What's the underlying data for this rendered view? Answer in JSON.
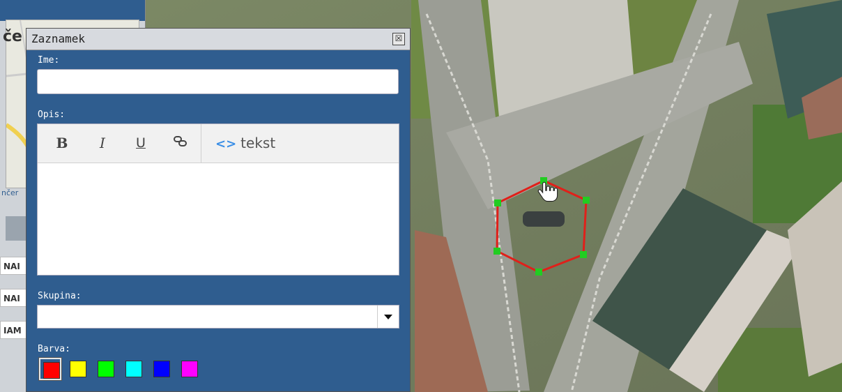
{
  "app": {
    "minimap_title": "če",
    "minimap_label": "nčer",
    "side_tabs": [
      "NAI",
      "NAI",
      "IAM"
    ]
  },
  "dialog": {
    "title": "Zaznamek",
    "close_glyph": "☒",
    "name_label": "Ime:",
    "name_value": "",
    "description_label": "Opis:",
    "toolbar": {
      "bold": "B",
      "italic": "I",
      "underline": "U",
      "link": "⚭",
      "source_icon": "<>",
      "source_label": "tekst"
    },
    "group_label": "Skupina:",
    "group_value": "",
    "color_label": "Barva:",
    "colors": [
      "#ff0000",
      "#ffff00",
      "#00ff00",
      "#00ffff",
      "#0000ff",
      "#ff00ff"
    ],
    "selected_color_index": 0
  },
  "drawing": {
    "stroke_color": "#e0201a",
    "vertex_color": "#22cc22"
  }
}
